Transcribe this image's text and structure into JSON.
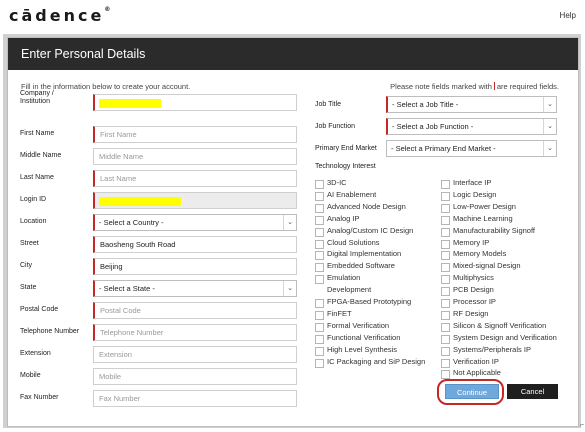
{
  "header": {
    "logo": "cādence",
    "logo_mark": "®",
    "help": "Help"
  },
  "panel": {
    "title": "Enter Personal Details",
    "intro": "Fill in the information below to create your account.",
    "note_before": "Please note fields marked with",
    "note_after": "are required fields."
  },
  "left_fields": [
    {
      "label": "Company /\nInstitution",
      "placeholder": "",
      "value": "",
      "required": true,
      "highlight": true
    },
    {
      "label": "First Name",
      "placeholder": "First Name",
      "value": "",
      "required": true
    },
    {
      "label": "Middle Name",
      "placeholder": "Middle Name",
      "value": "",
      "required": false
    },
    {
      "label": "Last Name",
      "placeholder": "Last Name",
      "value": "",
      "required": true
    },
    {
      "label": "Login ID",
      "placeholder": "",
      "value": "",
      "required": true,
      "highlight": true,
      "disabled": true
    },
    {
      "label": "Location",
      "select": true,
      "value": "- Select a Country -",
      "required": true
    },
    {
      "label": "Street",
      "placeholder": "",
      "value": "Baosheng South  Road",
      "required": true
    },
    {
      "label": "City",
      "placeholder": "",
      "value": "Beijing",
      "required": true
    },
    {
      "label": "State",
      "select": true,
      "value": "- Select a State -",
      "required": true
    },
    {
      "label": "Postal Code",
      "placeholder": "Postal Code",
      "value": "",
      "required": true
    },
    {
      "label": "Telephone Number",
      "placeholder": "Telephone Number",
      "value": "",
      "required": true
    },
    {
      "label": "Extension",
      "placeholder": "Extension",
      "value": "",
      "required": false
    },
    {
      "label": "Mobile",
      "placeholder": "Mobile",
      "value": "",
      "required": false
    },
    {
      "label": "Fax Number",
      "placeholder": "Fax Number",
      "value": "",
      "required": false
    }
  ],
  "right_selects": [
    {
      "label": "Job Title",
      "value": "- Select a Job Title -",
      "required": true
    },
    {
      "label": "Job Function",
      "value": "- Select a Job Function -",
      "required": true
    },
    {
      "label": "Primary End Market",
      "value": "- Select a Primary End Market -",
      "required": false
    }
  ],
  "technology": {
    "label": "Technology Interest",
    "col1": [
      "3D-IC",
      "AI Enablement",
      "Advanced Node Design",
      "Analog IP",
      "Analog/Custom IC Design",
      "Cloud Solutions",
      "Digital Implementation",
      "Embedded Software",
      "Emulation",
      "FPGA-Based Prototyping",
      "FinFET",
      "Formal Verification",
      "Functional Verification",
      "High Level Synthesis",
      "IC Packaging and SiP Design"
    ],
    "col1_indent": {
      "8": "Development"
    },
    "col2": [
      "Interface IP",
      "Logic Design",
      "Low-Power Design",
      "Machine Learning",
      "Manufacturability Signoff",
      "Memory IP",
      "Memory Models",
      "Mixed-signal Design",
      "Multiphysics",
      "PCB Design",
      "Processor IP",
      "RF Design",
      "Silicon & Signoff Verification",
      "System Design and Verification",
      "Systems/Peripherals IP",
      "Verification IP",
      "Not Applicable"
    ]
  },
  "buttons": {
    "continue": "Continue",
    "cancel": "Cancel"
  },
  "colors": {
    "required": "#c62828",
    "header": "#2b2b2b",
    "continue": "#6fa8dc",
    "highlight": "#ffff00"
  }
}
